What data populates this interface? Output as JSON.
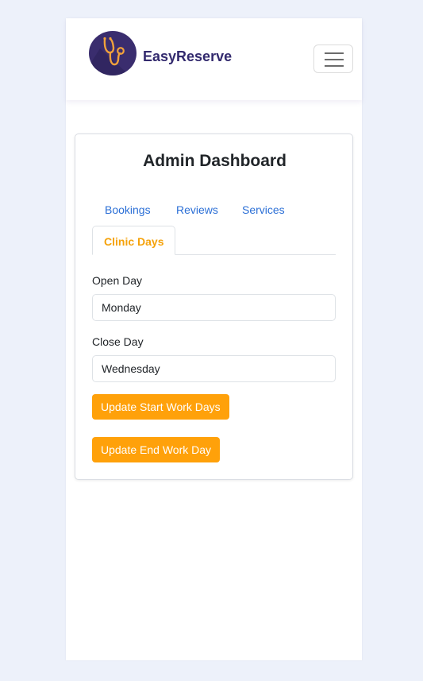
{
  "navbar": {
    "brand": "EasyReserve",
    "logo_icon": "stethoscope-icon",
    "menu_icon": "hamburger-menu-icon"
  },
  "dashboard": {
    "title": "Admin Dashboard",
    "tabs": [
      {
        "label": "Bookings",
        "active": false
      },
      {
        "label": "Reviews",
        "active": false
      },
      {
        "label": "Services",
        "active": false
      },
      {
        "label": "Clinic Days",
        "active": true
      }
    ]
  },
  "form": {
    "open_day_label": "Open Day",
    "open_day_value": "Monday",
    "close_day_label": "Close Day",
    "close_day_value": "Wednesday",
    "update_start_label": "Update Start Work Days",
    "update_end_label": "Update End Work Day"
  },
  "colors": {
    "accent": "#ffa10a",
    "link": "#2b6fd6",
    "brand": "#332a6e",
    "logo_bg": "#3a2d6e",
    "page_bg": "#edf1fa"
  }
}
